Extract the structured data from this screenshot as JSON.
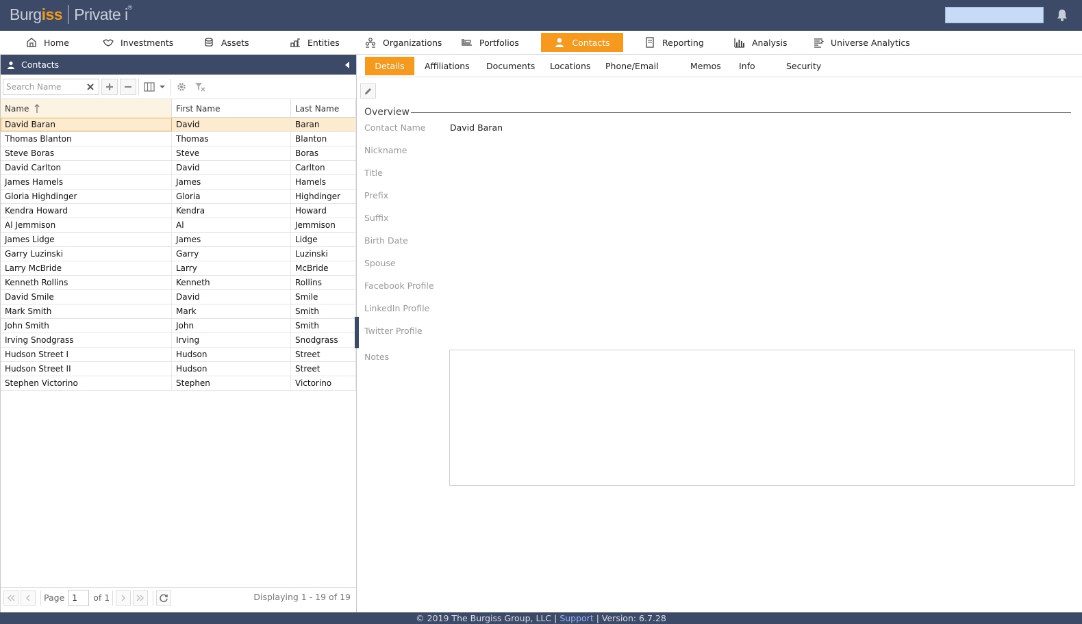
{
  "header": {
    "logo_part1": "Burg",
    "logo_part2": "iss",
    "logo_part3": "Private i",
    "logo_reg": "®"
  },
  "nav": {
    "items": [
      {
        "label": "Home",
        "icon": "home-icon"
      },
      {
        "label": "Investments",
        "icon": "handshake-icon"
      },
      {
        "label": "Assets",
        "icon": "coins-icon"
      },
      {
        "label": "Entities",
        "icon": "entities-icon"
      },
      {
        "label": "Organizations",
        "icon": "organizations-icon"
      },
      {
        "label": "Portfolios",
        "icon": "portfolio-icon"
      },
      {
        "label": "Contacts",
        "icon": "user-icon"
      },
      {
        "label": "Reporting",
        "icon": "report-icon"
      },
      {
        "label": "Analysis",
        "icon": "bar-chart-icon"
      },
      {
        "label": "Universe Analytics",
        "icon": "analytics-icon"
      }
    ],
    "active": "Contacts"
  },
  "left_panel": {
    "title": "Contacts",
    "search_placeholder": "Search Name",
    "columns": [
      "Name",
      "First Name",
      "Last Name"
    ],
    "rows": [
      [
        "David Baran",
        "David",
        "Baran"
      ],
      [
        "Thomas Blanton",
        "Thomas",
        "Blanton"
      ],
      [
        "Steve Boras",
        "Steve",
        "Boras"
      ],
      [
        "David Carlton",
        "David",
        "Carlton"
      ],
      [
        "James Hamels",
        "James",
        "Hamels"
      ],
      [
        "Gloria Highdinger",
        "Gloria",
        "Highdinger"
      ],
      [
        "Kendra Howard",
        "Kendra",
        "Howard"
      ],
      [
        "Al Jemmison",
        "Al",
        "Jemmison"
      ],
      [
        "James Lidge",
        "James",
        "Lidge"
      ],
      [
        "Garry Luzinski",
        "Garry",
        "Luzinski"
      ],
      [
        "Larry McBride",
        "Larry",
        "McBride"
      ],
      [
        "Kenneth Rollins",
        "Kenneth",
        "Rollins"
      ],
      [
        "David Smile",
        "David",
        "Smile"
      ],
      [
        "Mark Smith",
        "Mark",
        "Smith"
      ],
      [
        "John Smith",
        "John",
        "Smith"
      ],
      [
        "Irving Snodgrass",
        "Irving",
        "Snodgrass"
      ],
      [
        "Hudson Street I",
        "Hudson",
        "Street"
      ],
      [
        "Hudson Street II",
        "Hudson",
        "Street"
      ],
      [
        "Stephen Victorino",
        "Stephen",
        "Victorino"
      ]
    ],
    "pager": {
      "page_label": "Page",
      "page_value": "1",
      "of_label": "of 1",
      "display_text": "Displaying 1 - 19 of 19"
    }
  },
  "detail": {
    "tabs": [
      "Details",
      "Affiliations",
      "Documents",
      "Locations",
      "Phone/Email",
      "Memos",
      "Info",
      "Security"
    ],
    "active_tab": "Details",
    "section_title": "Overview",
    "fields": [
      {
        "label": "Contact Name",
        "value": "David Baran"
      },
      {
        "label": "Nickname",
        "value": ""
      },
      {
        "label": "Title",
        "value": ""
      },
      {
        "label": "Prefix",
        "value": ""
      },
      {
        "label": "Suffix",
        "value": ""
      },
      {
        "label": "Birth Date",
        "value": ""
      },
      {
        "label": "Spouse",
        "value": ""
      },
      {
        "label": "Facebook Profile",
        "value": ""
      },
      {
        "label": "LinkedIn Profile",
        "value": ""
      },
      {
        "label": "Twitter Profile",
        "value": ""
      }
    ],
    "notes_label": "Notes"
  },
  "footer": {
    "copyright": "© 2019 The Burgiss Group, LLC |",
    "support": "Support",
    "version": "| Version: 6.7.28"
  },
  "colors": {
    "header_bg": "#3c4a68",
    "accent": "#f59a1e",
    "selected_row": "#fdebcf"
  }
}
